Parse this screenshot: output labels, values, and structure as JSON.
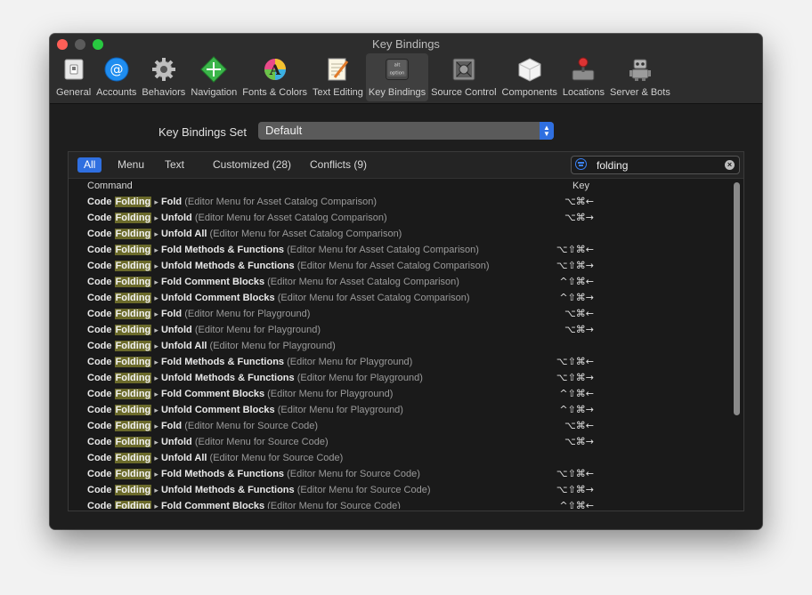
{
  "window": {
    "title": "Key Bindings"
  },
  "toolbar": {
    "items": [
      {
        "label": "General",
        "icon": "general-switch-icon"
      },
      {
        "label": "Accounts",
        "icon": "at-sign-icon"
      },
      {
        "label": "Behaviors",
        "icon": "gear-icon"
      },
      {
        "label": "Navigation",
        "icon": "navigation-arrows-icon"
      },
      {
        "label": "Fonts & Colors",
        "icon": "font-color-icon"
      },
      {
        "label": "Text Editing",
        "icon": "notepad-icon"
      },
      {
        "label": "Key Bindings",
        "icon": "option-key-icon",
        "key_top": "alt",
        "key_bottom": "option"
      },
      {
        "label": "Source Control",
        "icon": "safe-vault-icon"
      },
      {
        "label": "Components",
        "icon": "package-box-icon"
      },
      {
        "label": "Locations",
        "icon": "joystick-icon"
      },
      {
        "label": "Server & Bots",
        "icon": "robot-icon"
      }
    ],
    "active_index": 6
  },
  "key_bindings_set": {
    "label": "Key Bindings Set",
    "value": "Default"
  },
  "filters": {
    "all": "All",
    "menu": "Menu",
    "text": "Text",
    "customized": "Customized (28)",
    "conflicts": "Conflicts (9)"
  },
  "search": {
    "value": "folding"
  },
  "table": {
    "headers": {
      "command": "Command",
      "key": "Key"
    },
    "rows": [
      {
        "prefix": "Code",
        "highlight": "Folding",
        "action": "Fold",
        "context": "(Editor Menu for Asset Catalog Comparison)",
        "key": "⌥⌘←"
      },
      {
        "prefix": "Code",
        "highlight": "Folding",
        "action": "Unfold",
        "context": "(Editor Menu for Asset Catalog Comparison)",
        "key": "⌥⌘→"
      },
      {
        "prefix": "Code",
        "highlight": "Folding",
        "action": "Unfold All",
        "context": "(Editor Menu for Asset Catalog Comparison)",
        "key": ""
      },
      {
        "prefix": "Code",
        "highlight": "Folding",
        "action": "Fold Methods & Functions",
        "context": "(Editor Menu for Asset Catalog Comparison)",
        "key": "⌥⇧⌘←"
      },
      {
        "prefix": "Code",
        "highlight": "Folding",
        "action": "Unfold Methods & Functions",
        "context": "(Editor Menu for Asset Catalog Comparison)",
        "key": "⌥⇧⌘→"
      },
      {
        "prefix": "Code",
        "highlight": "Folding",
        "action": "Fold Comment Blocks",
        "context": "(Editor Menu for Asset Catalog Comparison)",
        "key": "^⇧⌘←"
      },
      {
        "prefix": "Code",
        "highlight": "Folding",
        "action": "Unfold Comment Blocks",
        "context": "(Editor Menu for Asset Catalog Comparison)",
        "key": "^⇧⌘→"
      },
      {
        "prefix": "Code",
        "highlight": "Folding",
        "action": "Fold",
        "context": "(Editor Menu for Playground)",
        "key": "⌥⌘←"
      },
      {
        "prefix": "Code",
        "highlight": "Folding",
        "action": "Unfold",
        "context": "(Editor Menu for Playground)",
        "key": "⌥⌘→"
      },
      {
        "prefix": "Code",
        "highlight": "Folding",
        "action": "Unfold All",
        "context": "(Editor Menu for Playground)",
        "key": ""
      },
      {
        "prefix": "Code",
        "highlight": "Folding",
        "action": "Fold Methods & Functions",
        "context": "(Editor Menu for Playground)",
        "key": "⌥⇧⌘←"
      },
      {
        "prefix": "Code",
        "highlight": "Folding",
        "action": "Unfold Methods & Functions",
        "context": "(Editor Menu for Playground)",
        "key": "⌥⇧⌘→"
      },
      {
        "prefix": "Code",
        "highlight": "Folding",
        "action": "Fold Comment Blocks",
        "context": "(Editor Menu for Playground)",
        "key": "^⇧⌘←"
      },
      {
        "prefix": "Code",
        "highlight": "Folding",
        "action": "Unfold Comment Blocks",
        "context": "(Editor Menu for Playground)",
        "key": "^⇧⌘→"
      },
      {
        "prefix": "Code",
        "highlight": "Folding",
        "action": "Fold",
        "context": "(Editor Menu for Source Code)",
        "key": "⌥⌘←"
      },
      {
        "prefix": "Code",
        "highlight": "Folding",
        "action": "Unfold",
        "context": "(Editor Menu for Source Code)",
        "key": "⌥⌘→"
      },
      {
        "prefix": "Code",
        "highlight": "Folding",
        "action": "Unfold All",
        "context": "(Editor Menu for Source Code)",
        "key": ""
      },
      {
        "prefix": "Code",
        "highlight": "Folding",
        "action": "Fold Methods & Functions",
        "context": "(Editor Menu for Source Code)",
        "key": "⌥⇧⌘←"
      },
      {
        "prefix": "Code",
        "highlight": "Folding",
        "action": "Unfold Methods & Functions",
        "context": "(Editor Menu for Source Code)",
        "key": "⌥⇧⌘→"
      },
      {
        "prefix": "Code",
        "highlight": "Folding",
        "action": "Fold Comment Blocks",
        "context": "(Editor Menu for Source Code)",
        "key": "^⇧⌘←"
      }
    ]
  },
  "colors": {
    "accent": "#2f6fe0",
    "highlight": "#6b6a2a",
    "window_bg": "#1e1e1e"
  }
}
